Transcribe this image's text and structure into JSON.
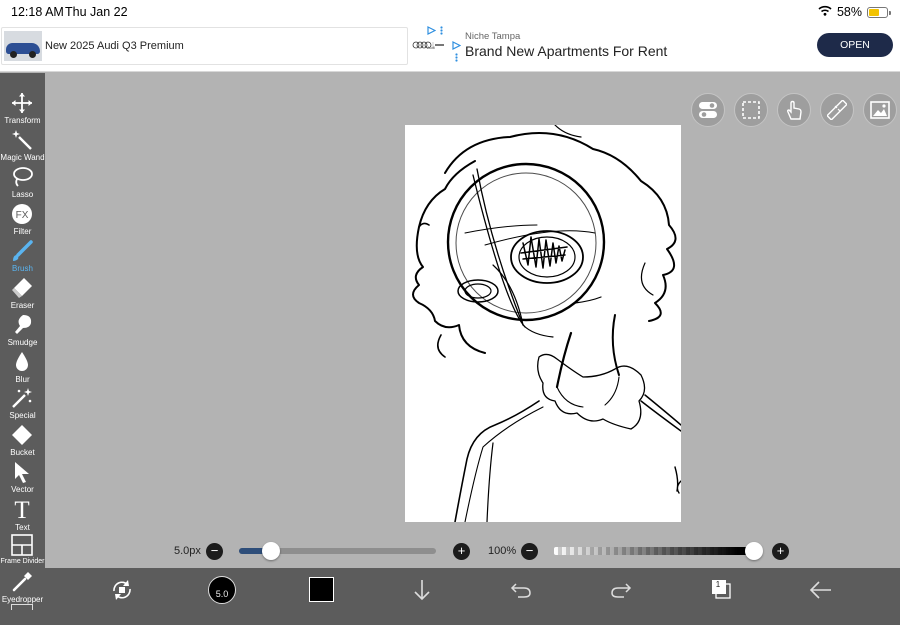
{
  "status_bar": {
    "time": "12:18 AM",
    "date": "Thu Jan 22",
    "battery_percent": "58%",
    "battery_level": 0.58
  },
  "ad": {
    "left_text": "New 2025 Audi Q3 Premium",
    "brand_logo_text": "Audi",
    "right_brand": "Niche Tampa",
    "right_title": "Brand New Apartments For Rent",
    "open_label": "OPEN"
  },
  "tools": [
    {
      "key": "transform",
      "label": "Transform",
      "icon": "move-arrows-icon"
    },
    {
      "key": "magic-wand",
      "label": "Magic Wand",
      "icon": "magic-wand-icon"
    },
    {
      "key": "lasso",
      "label": "Lasso",
      "icon": "lasso-icon"
    },
    {
      "key": "filter",
      "label": "Filter",
      "icon": "fx-icon",
      "glyph": "FX"
    },
    {
      "key": "brush",
      "label": "Brush",
      "icon": "brush-icon",
      "active": true
    },
    {
      "key": "eraser",
      "label": "Eraser",
      "icon": "eraser-icon"
    },
    {
      "key": "smudge",
      "label": "Smudge",
      "icon": "smudge-icon"
    },
    {
      "key": "blur",
      "label": "Blur",
      "icon": "droplet-icon"
    },
    {
      "key": "special",
      "label": "Special",
      "icon": "sparkle-icon"
    },
    {
      "key": "bucket",
      "label": "Bucket",
      "icon": "bucket-icon"
    },
    {
      "key": "vector",
      "label": "Vector",
      "icon": "cursor-arrow-icon"
    },
    {
      "key": "text",
      "label": "Text",
      "icon": "text-icon",
      "glyph": "T"
    },
    {
      "key": "frame-divider",
      "label": "Frame Divider",
      "icon": "frame-divider-icon"
    },
    {
      "key": "eyedropper",
      "label": "Eyedropper",
      "icon": "eyedropper-icon"
    }
  ],
  "top_icons": [
    "toggle-icon",
    "selection-icon",
    "hand-icon",
    "ruler-icon",
    "image-icon"
  ],
  "brush": {
    "size_label": "5.0px",
    "size_value": 5.0,
    "size_fraction": 0.16,
    "size_circle_text": "5.0"
  },
  "opacity": {
    "label": "100%",
    "fraction": 1.0
  },
  "bottom_icons": [
    "transform-canvas-icon",
    "brush-size-icon",
    "color-swatch-icon",
    "download-icon",
    "undo-icon",
    "redo-icon",
    "layers-icon",
    "back-arrow-icon"
  ],
  "layers": {
    "count": "1"
  },
  "colors": {
    "toolbar": "#5c5c5c",
    "workspace": "#b3b3b3",
    "active_tool": "#5ab4f0",
    "current_color": "#000000",
    "ad_button": "#1e2a49"
  }
}
